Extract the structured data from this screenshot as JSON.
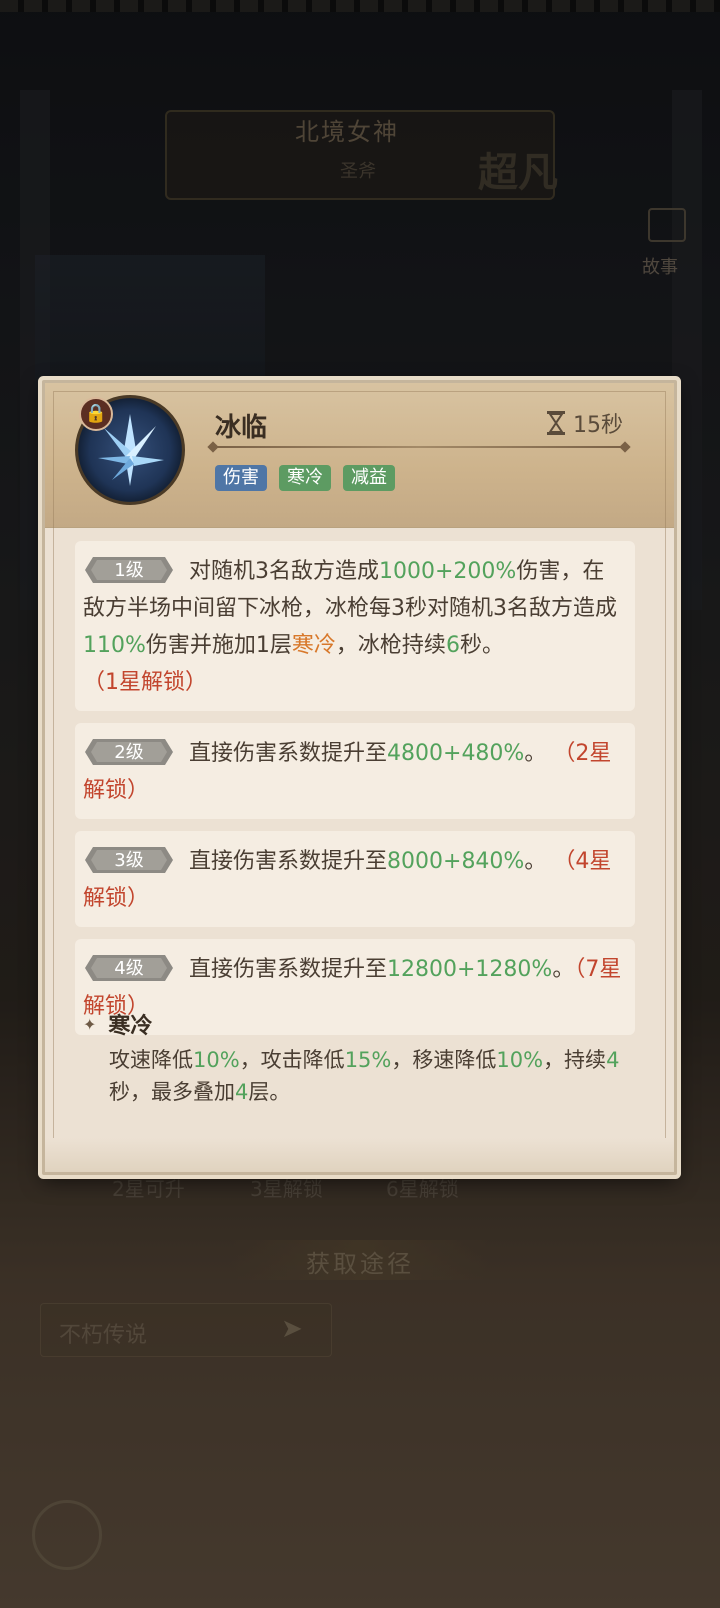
{
  "background": {
    "hero_name": "北境女神",
    "hero_class": "圣斧",
    "rank": "超凡",
    "story_label": "故事",
    "unlock_labels": [
      "2星可升",
      "3星解锁",
      "6星解锁"
    ],
    "source_title": "获取途径",
    "source_item": "不朽传说"
  },
  "skill": {
    "name": "冰临",
    "cooldown": "15秒",
    "icon": "ice-crystal-icon",
    "locked": true,
    "tags": [
      "伤害",
      "寒冷",
      "减益"
    ]
  },
  "levels": [
    {
      "badge": "1级",
      "segments": [
        {
          "t": "对随机3名敌方造成",
          "c": ""
        },
        {
          "t": "1000+200%",
          "c": "g"
        },
        {
          "t": "伤害，在敌方半场中间留下冰枪，冰枪每3秒对随机3名敌方造成",
          "c": ""
        },
        {
          "t": "110%",
          "c": "g"
        },
        {
          "t": "伤害并施加1层",
          "c": ""
        },
        {
          "t": "寒冷",
          "c": "o"
        },
        {
          "t": "，冰枪持续",
          "c": ""
        },
        {
          "t": "6",
          "c": "g"
        },
        {
          "t": "秒。 ",
          "c": ""
        },
        {
          "t": "（1星解锁）",
          "c": "r"
        }
      ]
    },
    {
      "badge": "2级",
      "segments": [
        {
          "t": "直接伤害系数提升至",
          "c": ""
        },
        {
          "t": "4800+480%",
          "c": "g"
        },
        {
          "t": "。 ",
          "c": ""
        },
        {
          "t": "（2星解锁）",
          "c": "r"
        }
      ]
    },
    {
      "badge": "3级",
      "segments": [
        {
          "t": "直接伤害系数提升至",
          "c": ""
        },
        {
          "t": "8000+840%",
          "c": "g"
        },
        {
          "t": "。 ",
          "c": ""
        },
        {
          "t": "（4星解锁）",
          "c": "r"
        }
      ]
    },
    {
      "badge": "4级",
      "segments": [
        {
          "t": "直接伤害系数提升至",
          "c": ""
        },
        {
          "t": "12800+1280%",
          "c": "g"
        },
        {
          "t": "。",
          "c": ""
        },
        {
          "t": "（7星解锁）",
          "c": "r"
        }
      ]
    }
  ],
  "chill": {
    "title": "寒冷",
    "segments": [
      {
        "t": "攻速降低",
        "c": ""
      },
      {
        "t": "10%",
        "c": "g"
      },
      {
        "t": "，攻击降低",
        "c": ""
      },
      {
        "t": "15%",
        "c": "g"
      },
      {
        "t": "，移速降低",
        "c": ""
      },
      {
        "t": "10%",
        "c": "g"
      },
      {
        "t": "，持续",
        "c": ""
      },
      {
        "t": "4",
        "c": "g"
      },
      {
        "t": "秒，最多叠加",
        "c": ""
      },
      {
        "t": "4",
        "c": "g"
      },
      {
        "t": "层。",
        "c": ""
      }
    ]
  },
  "colors": {
    "green": "#53a25c",
    "orange": "#d8782a",
    "red": "#c2452d",
    "tag_blue": "#4f76a6",
    "tag_green": "#5d9b62"
  }
}
